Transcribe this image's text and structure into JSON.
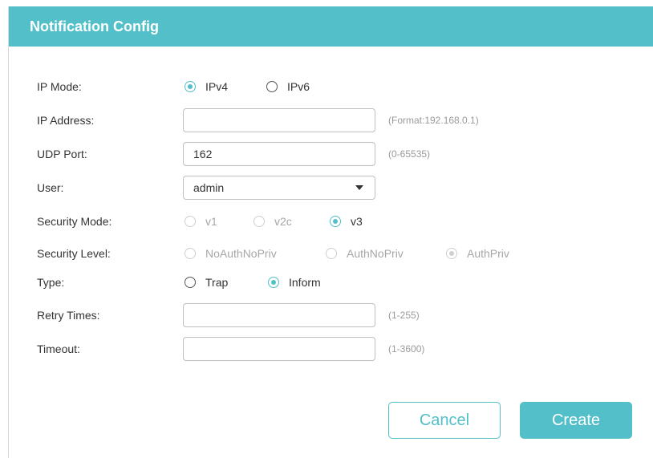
{
  "dialog": {
    "title": "Notification Config"
  },
  "fields": {
    "ip_mode": {
      "label": "IP Mode:",
      "options": [
        {
          "label": "IPv4",
          "checked": true,
          "disabled": false
        },
        {
          "label": "IPv6",
          "checked": false,
          "disabled": false
        }
      ]
    },
    "ip_address": {
      "label": "IP Address:",
      "value": "",
      "hint": "(Format:192.168.0.1)"
    },
    "udp_port": {
      "label": "UDP Port:",
      "value": "162",
      "hint": "(0-65535)"
    },
    "user": {
      "label": "User:",
      "selected": "admin"
    },
    "security_mode": {
      "label": "Security Mode:",
      "options": [
        {
          "label": "v1",
          "checked": false,
          "disabled": true
        },
        {
          "label": "v2c",
          "checked": false,
          "disabled": true
        },
        {
          "label": "v3",
          "checked": true,
          "disabled": false
        }
      ]
    },
    "security_level": {
      "label": "Security Level:",
      "options": [
        {
          "label": "NoAuthNoPriv",
          "checked": false,
          "disabled": true
        },
        {
          "label": "AuthNoPriv",
          "checked": false,
          "disabled": true
        },
        {
          "label": "AuthPriv",
          "checked": true,
          "disabled": true
        }
      ]
    },
    "type": {
      "label": "Type:",
      "options": [
        {
          "label": "Trap",
          "checked": false,
          "disabled": false
        },
        {
          "label": "Inform",
          "checked": true,
          "disabled": false
        }
      ]
    },
    "retry_times": {
      "label": "Retry Times:",
      "value": "",
      "hint": "(1-255)"
    },
    "timeout": {
      "label": "Timeout:",
      "value": "",
      "hint": "(1-3600)"
    }
  },
  "buttons": {
    "cancel": "Cancel",
    "create": "Create"
  },
  "colors": {
    "accent": "#52bfc9",
    "text": "#333333",
    "hint": "#9a9a9a",
    "disabled": "#cfcfcf"
  }
}
